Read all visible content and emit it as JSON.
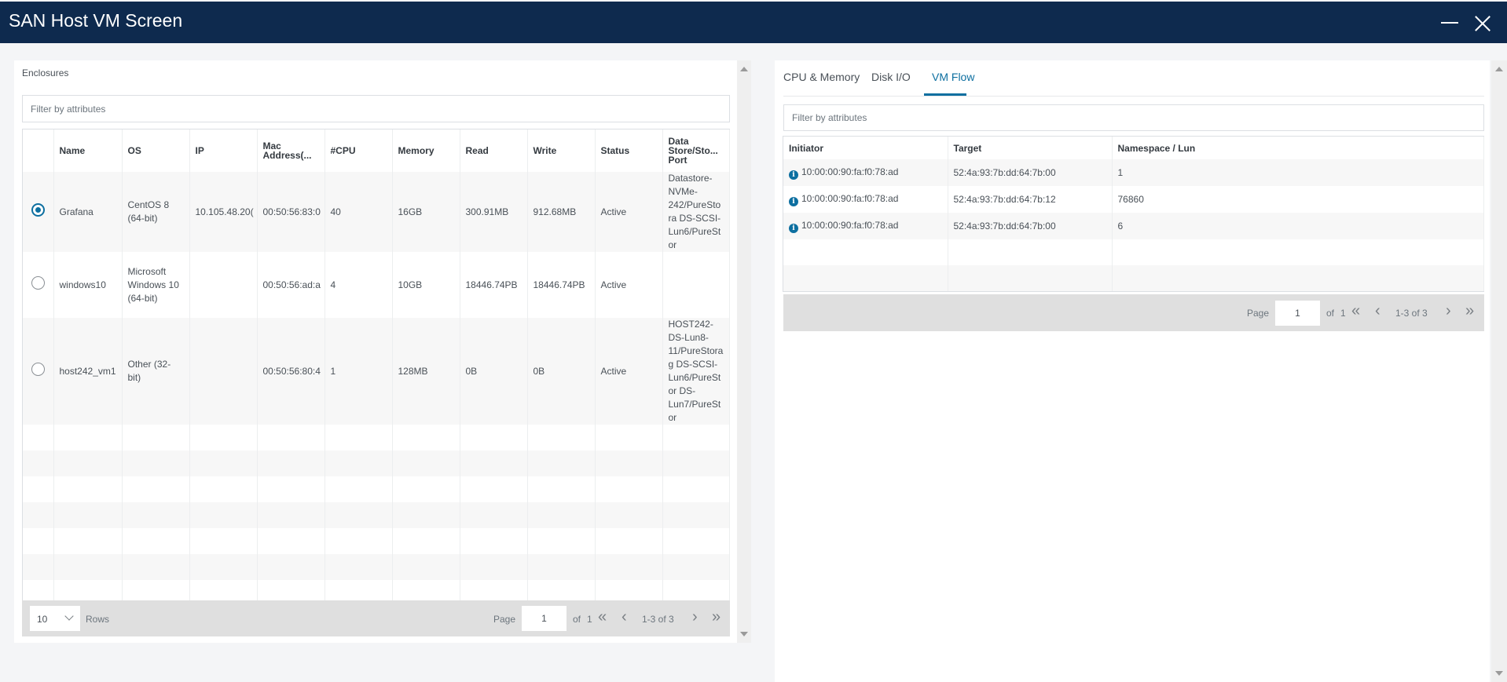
{
  "window": {
    "title": "SAN Host VM Screen",
    "minimize_icon": "minimize-icon",
    "close_icon": "close-icon"
  },
  "enclosures": {
    "label": "Enclosures",
    "filter_placeholder": "Filter by attributes",
    "columns": [
      "",
      "Name",
      "OS",
      "IP",
      "Mac Address(...",
      "#CPU",
      "Memory",
      "Read",
      "Write",
      "Status",
      "Data Store/Sto... Port"
    ],
    "rows": [
      {
        "selected": true,
        "name": "Grafana",
        "os": "CentOS 8 (64-bit)",
        "ip": "10.105.48.20(",
        "mac": "00:50:56:83:0",
        "cpu": "40",
        "memory": "16GB",
        "read": "300.91MB",
        "write": "912.68MB",
        "status": "Active",
        "datastore": "Datastore-NVMe-242/PureStora DS-SCSI-Lun6/PureStor"
      },
      {
        "selected": false,
        "name": "windows10",
        "os": "Microsoft Windows 10 (64-bit)",
        "ip": "",
        "mac": "00:50:56:ad:a",
        "cpu": "4",
        "memory": "10GB",
        "read": "18446.74PB",
        "write": "18446.74PB",
        "status": "Active",
        "datastore": ""
      },
      {
        "selected": false,
        "name": "host242_vm1",
        "os": "Other (32-bit)",
        "ip": "",
        "mac": "00:50:56:80:4",
        "cpu": "1",
        "memory": "128MB",
        "read": "0B",
        "write": "0B",
        "status": "Active",
        "datastore": "HOST242-DS-Lun8-11/PureStorag DS-SCSI-Lun6/PureStor DS-Lun7/PureStor"
      }
    ],
    "pagination": {
      "rows_per_page": "10",
      "rows_label": "Rows",
      "page_label": "Page",
      "page_value": "1",
      "of_label": "of",
      "total_pages": "1",
      "range": "1-3 of 3"
    }
  },
  "details": {
    "tabs": [
      {
        "label": "CPU & Memory",
        "active": false
      },
      {
        "label": "Disk I/O",
        "active": false
      },
      {
        "label": "VM Flow",
        "active": true
      }
    ],
    "filter_placeholder": "Filter by attributes",
    "columns": [
      "Initiator",
      "Target",
      "Namespace / Lun"
    ],
    "rows": [
      {
        "initiator": "10:00:00:90:fa:f0:78:ad",
        "target": "52:4a:93:7b:dd:64:7b:00",
        "lun": "1"
      },
      {
        "initiator": "10:00:00:90:fa:f0:78:ad",
        "target": "52:4a:93:7b:dd:64:7b:12",
        "lun": "76860"
      },
      {
        "initiator": "10:00:00:90:fa:f0:78:ad",
        "target": "52:4a:93:7b:dd:64:7b:00",
        "lun": "6"
      }
    ],
    "pagination": {
      "page_label": "Page",
      "page_value": "1",
      "of_label": "of",
      "total_pages": "1",
      "range": "1-3 of 3"
    }
  },
  "icons": {
    "first": "«",
    "prev": "‹",
    "next": "›",
    "last": "»",
    "info": "i"
  },
  "colors": {
    "titlebar": "#0e2a4e",
    "accent": "#0d6fa0"
  }
}
